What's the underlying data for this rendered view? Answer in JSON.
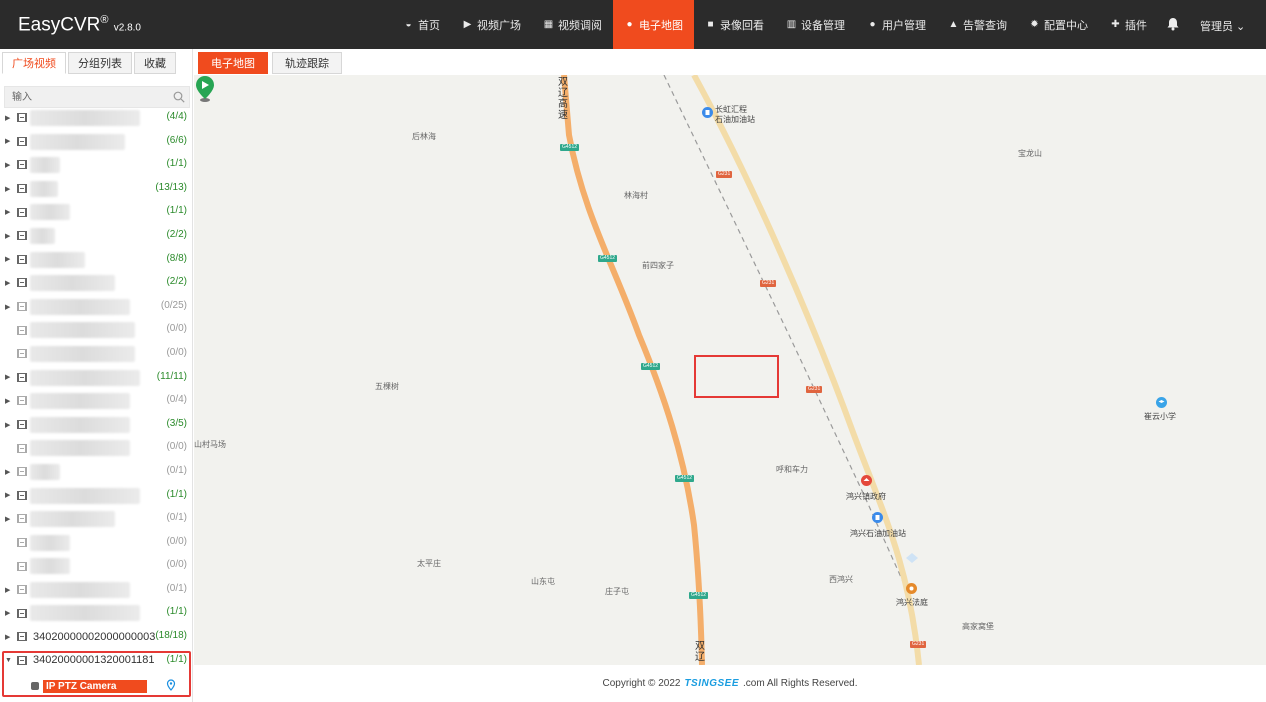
{
  "app": {
    "name": "EasyCVR",
    "reg": "®",
    "version": "v2.8.0"
  },
  "nav": [
    {
      "label": "首页",
      "icon": "dashboard-icon",
      "active": false
    },
    {
      "label": "视频广场",
      "icon": "play-circle-icon",
      "active": false
    },
    {
      "label": "视频调阅",
      "icon": "grid-icon",
      "active": false
    },
    {
      "label": "电子地图",
      "icon": "location-pin-icon",
      "active": true
    },
    {
      "label": "录像回看",
      "icon": "video-camera-icon",
      "active": false
    },
    {
      "label": "设备管理",
      "icon": "server-icon",
      "active": false
    },
    {
      "label": "用户管理",
      "icon": "user-icon",
      "active": false
    },
    {
      "label": "告警查询",
      "icon": "alarm-icon",
      "active": false
    },
    {
      "label": "配置中心",
      "icon": "gear-icon",
      "active": false
    },
    {
      "label": "插件",
      "icon": "puzzle-icon",
      "active": false
    }
  ],
  "user": {
    "label": "管理员 ⌄"
  },
  "left_tabs": [
    "广场视频",
    "分组列表",
    "收藏"
  ],
  "search": {
    "placeholder": "输入"
  },
  "tree": [
    {
      "count": "(4/4)",
      "online": true,
      "expand": true,
      "label": ""
    },
    {
      "count": "(6/6)",
      "online": true,
      "expand": true,
      "label": ""
    },
    {
      "count": "(1/1)",
      "online": true,
      "expand": true,
      "label": ""
    },
    {
      "count": "(13/13)",
      "online": true,
      "expand": true,
      "label": ""
    },
    {
      "count": "(1/1)",
      "online": true,
      "expand": true,
      "label": ""
    },
    {
      "count": "(2/2)",
      "online": true,
      "expand": true,
      "label": ""
    },
    {
      "count": "(8/8)",
      "online": true,
      "expand": true,
      "label": ""
    },
    {
      "count": "(2/2)",
      "online": true,
      "expand": true,
      "label": ""
    },
    {
      "count": "(0/25)",
      "online": false,
      "expand": true,
      "label": ""
    },
    {
      "count": "(0/0)",
      "online": false,
      "expand": false,
      "label": ""
    },
    {
      "count": "(0/0)",
      "online": false,
      "expand": false,
      "label": ""
    },
    {
      "count": "(11/11)",
      "online": true,
      "expand": true,
      "label": ""
    },
    {
      "count": "(0/4)",
      "online": false,
      "expand": true,
      "label": ""
    },
    {
      "count": "(3/5)",
      "online": true,
      "expand": true,
      "label": ""
    },
    {
      "count": "(0/0)",
      "online": false,
      "expand": false,
      "label": ""
    },
    {
      "count": "(0/1)",
      "online": false,
      "expand": true,
      "label": ""
    },
    {
      "count": "(1/1)",
      "online": true,
      "expand": true,
      "label": ""
    },
    {
      "count": "(0/1)",
      "online": false,
      "expand": true,
      "label": ""
    },
    {
      "count": "(0/0)",
      "online": false,
      "expand": false,
      "label": ""
    },
    {
      "count": "(0/0)",
      "online": false,
      "expand": false,
      "label": ""
    },
    {
      "count": "(0/1)",
      "online": false,
      "expand": true,
      "label": ""
    },
    {
      "count": "(1/1)",
      "online": true,
      "expand": true,
      "label": ""
    },
    {
      "count": "(18/18)",
      "online": true,
      "expand": true,
      "label": "34020000002000000003"
    },
    {
      "count": "(1/1)",
      "online": true,
      "expand": true,
      "open": true,
      "label": "34020000001320001181"
    }
  ],
  "camera": {
    "label": "IP PTZ Camera"
  },
  "main_tabs": [
    "电子地图",
    "轨迹跟踪"
  ],
  "map": {
    "places": [
      {
        "text": "后林海"
      },
      {
        "text": "林海村"
      },
      {
        "text": "前四家子"
      },
      {
        "text": "五棵树"
      },
      {
        "text": "山村马场"
      },
      {
        "text": "呼和车力"
      },
      {
        "text": "太平庄"
      },
      {
        "text": "山东屯"
      },
      {
        "text": "庄子屯"
      },
      {
        "text": "西鸿兴"
      },
      {
        "text": "高家窝堡"
      },
      {
        "text": "宝龙山"
      }
    ],
    "pois": [
      {
        "line1": "长虹汇程",
        "line2": "石油加油站"
      },
      {
        "text": "鸿兴镇政府"
      },
      {
        "text": "鸿兴石油加油站"
      },
      {
        "text": "鸿兴法庭"
      },
      {
        "text": "崔云小学"
      }
    ],
    "highway_name": "双辽高速",
    "highway_name_bottom": "双辽",
    "shields": [
      "G4512",
      "G4512",
      "G4512",
      "G4512",
      "G4512",
      "G231",
      "G231",
      "G231",
      "G231"
    ]
  },
  "footer": {
    "prefix": "Copyright © 2022",
    "brand": "TSINGSEE",
    "suffix": ".com All Rights Reserved."
  }
}
